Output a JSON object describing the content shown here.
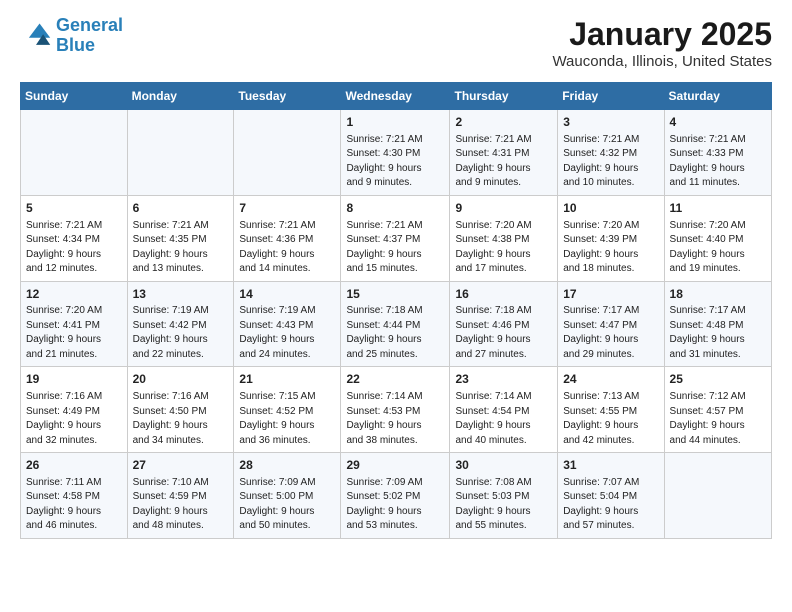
{
  "header": {
    "logo_line1": "General",
    "logo_line2": "Blue",
    "title": "January 2025",
    "subtitle": "Wauconda, Illinois, United States"
  },
  "days_of_week": [
    "Sunday",
    "Monday",
    "Tuesday",
    "Wednesday",
    "Thursday",
    "Friday",
    "Saturday"
  ],
  "weeks": [
    [
      {
        "day": null,
        "content": null
      },
      {
        "day": null,
        "content": null
      },
      {
        "day": null,
        "content": null
      },
      {
        "day": "1",
        "content": "Sunrise: 7:21 AM\nSunset: 4:30 PM\nDaylight: 9 hours\nand 9 minutes."
      },
      {
        "day": "2",
        "content": "Sunrise: 7:21 AM\nSunset: 4:31 PM\nDaylight: 9 hours\nand 9 minutes."
      },
      {
        "day": "3",
        "content": "Sunrise: 7:21 AM\nSunset: 4:32 PM\nDaylight: 9 hours\nand 10 minutes."
      },
      {
        "day": "4",
        "content": "Sunrise: 7:21 AM\nSunset: 4:33 PM\nDaylight: 9 hours\nand 11 minutes."
      }
    ],
    [
      {
        "day": "5",
        "content": "Sunrise: 7:21 AM\nSunset: 4:34 PM\nDaylight: 9 hours\nand 12 minutes."
      },
      {
        "day": "6",
        "content": "Sunrise: 7:21 AM\nSunset: 4:35 PM\nDaylight: 9 hours\nand 13 minutes."
      },
      {
        "day": "7",
        "content": "Sunrise: 7:21 AM\nSunset: 4:36 PM\nDaylight: 9 hours\nand 14 minutes."
      },
      {
        "day": "8",
        "content": "Sunrise: 7:21 AM\nSunset: 4:37 PM\nDaylight: 9 hours\nand 15 minutes."
      },
      {
        "day": "9",
        "content": "Sunrise: 7:20 AM\nSunset: 4:38 PM\nDaylight: 9 hours\nand 17 minutes."
      },
      {
        "day": "10",
        "content": "Sunrise: 7:20 AM\nSunset: 4:39 PM\nDaylight: 9 hours\nand 18 minutes."
      },
      {
        "day": "11",
        "content": "Sunrise: 7:20 AM\nSunset: 4:40 PM\nDaylight: 9 hours\nand 19 minutes."
      }
    ],
    [
      {
        "day": "12",
        "content": "Sunrise: 7:20 AM\nSunset: 4:41 PM\nDaylight: 9 hours\nand 21 minutes."
      },
      {
        "day": "13",
        "content": "Sunrise: 7:19 AM\nSunset: 4:42 PM\nDaylight: 9 hours\nand 22 minutes."
      },
      {
        "day": "14",
        "content": "Sunrise: 7:19 AM\nSunset: 4:43 PM\nDaylight: 9 hours\nand 24 minutes."
      },
      {
        "day": "15",
        "content": "Sunrise: 7:18 AM\nSunset: 4:44 PM\nDaylight: 9 hours\nand 25 minutes."
      },
      {
        "day": "16",
        "content": "Sunrise: 7:18 AM\nSunset: 4:46 PM\nDaylight: 9 hours\nand 27 minutes."
      },
      {
        "day": "17",
        "content": "Sunrise: 7:17 AM\nSunset: 4:47 PM\nDaylight: 9 hours\nand 29 minutes."
      },
      {
        "day": "18",
        "content": "Sunrise: 7:17 AM\nSunset: 4:48 PM\nDaylight: 9 hours\nand 31 minutes."
      }
    ],
    [
      {
        "day": "19",
        "content": "Sunrise: 7:16 AM\nSunset: 4:49 PM\nDaylight: 9 hours\nand 32 minutes."
      },
      {
        "day": "20",
        "content": "Sunrise: 7:16 AM\nSunset: 4:50 PM\nDaylight: 9 hours\nand 34 minutes."
      },
      {
        "day": "21",
        "content": "Sunrise: 7:15 AM\nSunset: 4:52 PM\nDaylight: 9 hours\nand 36 minutes."
      },
      {
        "day": "22",
        "content": "Sunrise: 7:14 AM\nSunset: 4:53 PM\nDaylight: 9 hours\nand 38 minutes."
      },
      {
        "day": "23",
        "content": "Sunrise: 7:14 AM\nSunset: 4:54 PM\nDaylight: 9 hours\nand 40 minutes."
      },
      {
        "day": "24",
        "content": "Sunrise: 7:13 AM\nSunset: 4:55 PM\nDaylight: 9 hours\nand 42 minutes."
      },
      {
        "day": "25",
        "content": "Sunrise: 7:12 AM\nSunset: 4:57 PM\nDaylight: 9 hours\nand 44 minutes."
      }
    ],
    [
      {
        "day": "26",
        "content": "Sunrise: 7:11 AM\nSunset: 4:58 PM\nDaylight: 9 hours\nand 46 minutes."
      },
      {
        "day": "27",
        "content": "Sunrise: 7:10 AM\nSunset: 4:59 PM\nDaylight: 9 hours\nand 48 minutes."
      },
      {
        "day": "28",
        "content": "Sunrise: 7:09 AM\nSunset: 5:00 PM\nDaylight: 9 hours\nand 50 minutes."
      },
      {
        "day": "29",
        "content": "Sunrise: 7:09 AM\nSunset: 5:02 PM\nDaylight: 9 hours\nand 53 minutes."
      },
      {
        "day": "30",
        "content": "Sunrise: 7:08 AM\nSunset: 5:03 PM\nDaylight: 9 hours\nand 55 minutes."
      },
      {
        "day": "31",
        "content": "Sunrise: 7:07 AM\nSunset: 5:04 PM\nDaylight: 9 hours\nand 57 minutes."
      },
      {
        "day": null,
        "content": null
      }
    ]
  ]
}
